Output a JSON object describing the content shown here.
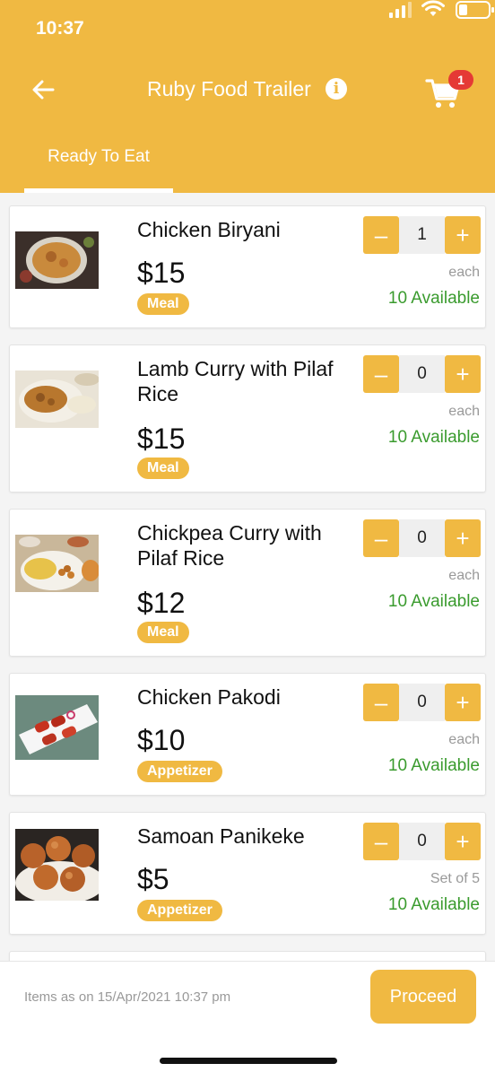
{
  "status_bar": {
    "time": "10:37"
  },
  "header": {
    "title": "Ruby Food Trailer",
    "info_glyph": "i",
    "cart_count": "1",
    "tab_label": "Ready To Eat",
    "accent_color": "#f0b942"
  },
  "items": [
    {
      "name": "Chicken Biryani",
      "price": "$15",
      "category": "Meal",
      "quantity": "1",
      "unit": "each",
      "availability": "10 Available",
      "image": "biryani-plate"
    },
    {
      "name": "Lamb Curry with Pilaf Rice",
      "price": "$15",
      "category": "Meal",
      "quantity": "0",
      "unit": "each",
      "availability": "10 Available",
      "image": "lamb-curry-plate"
    },
    {
      "name": "Chickpea Curry with Pilaf Rice",
      "price": "$12",
      "category": "Meal",
      "quantity": "0",
      "unit": "each",
      "availability": "10 Available",
      "image": "chickpea-curry-plate"
    },
    {
      "name": "Chicken Pakodi",
      "price": "$10",
      "category": "Appetizer",
      "quantity": "0",
      "unit": "each",
      "availability": "10 Available",
      "image": "pakodi-plate"
    },
    {
      "name": "Samoan Panikeke",
      "price": "$5",
      "category": "Appetizer",
      "quantity": "0",
      "unit": "Set of 5",
      "availability": "10 Available",
      "image": "panikeke-plate"
    }
  ],
  "stepper": {
    "minus": "–",
    "plus": "+"
  },
  "footer": {
    "note": "Items as on 15/Apr/2021 10:37 pm",
    "proceed_label": "Proceed"
  }
}
